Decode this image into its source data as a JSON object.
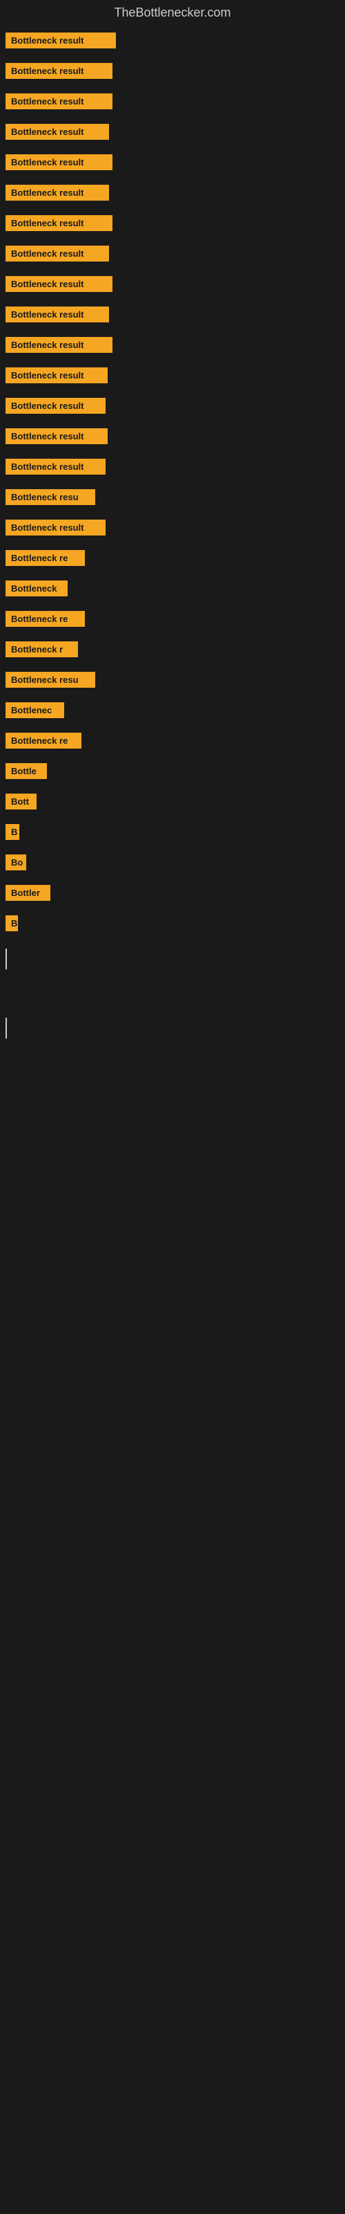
{
  "header": {
    "title": "TheBottlenecker.com"
  },
  "bars": [
    {
      "label": "Bottleneck result",
      "width": 160
    },
    {
      "label": "Bottleneck result",
      "width": 155
    },
    {
      "label": "Bottleneck result",
      "width": 155
    },
    {
      "label": "Bottleneck result",
      "width": 150
    },
    {
      "label": "Bottleneck result",
      "width": 155
    },
    {
      "label": "Bottleneck result",
      "width": 150
    },
    {
      "label": "Bottleneck result",
      "width": 155
    },
    {
      "label": "Bottleneck result",
      "width": 150
    },
    {
      "label": "Bottleneck result",
      "width": 155
    },
    {
      "label": "Bottleneck result",
      "width": 150
    },
    {
      "label": "Bottleneck result",
      "width": 155
    },
    {
      "label": "Bottleneck result",
      "width": 148
    },
    {
      "label": "Bottleneck result",
      "width": 145
    },
    {
      "label": "Bottleneck result",
      "width": 148
    },
    {
      "label": "Bottleneck result",
      "width": 145
    },
    {
      "label": "Bottleneck resu",
      "width": 130
    },
    {
      "label": "Bottleneck result",
      "width": 145
    },
    {
      "label": "Bottleneck re",
      "width": 115
    },
    {
      "label": "Bottleneck",
      "width": 90
    },
    {
      "label": "Bottleneck re",
      "width": 115
    },
    {
      "label": "Bottleneck r",
      "width": 105
    },
    {
      "label": "Bottleneck resu",
      "width": 130
    },
    {
      "label": "Bottlenec",
      "width": 85
    },
    {
      "label": "Bottleneck re",
      "width": 110
    },
    {
      "label": "Bottle",
      "width": 60
    },
    {
      "label": "Bott",
      "width": 45
    },
    {
      "label": "B",
      "width": 20
    },
    {
      "label": "Bo",
      "width": 30
    },
    {
      "label": "Bottler",
      "width": 65
    },
    {
      "label": "B",
      "width": 18
    }
  ]
}
